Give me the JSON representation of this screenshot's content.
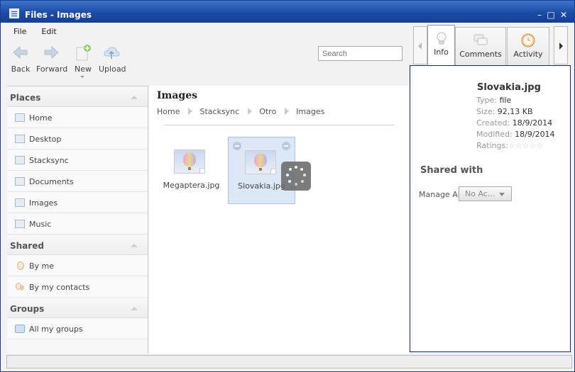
{
  "window": {
    "title": "Files - Images",
    "controls": [
      "minimize-icon",
      "maximize-icon",
      "close-icon"
    ]
  },
  "menu": {
    "items": [
      "File",
      "Edit"
    ]
  },
  "toolbar": {
    "back": "Back",
    "forward": "Forward",
    "new": "New",
    "upload": "Upload"
  },
  "search": {
    "placeholder": "Search"
  },
  "sidebar": {
    "places_title": "Places",
    "places": [
      "Home",
      "Desktop",
      "Stacksync",
      "Documents",
      "Images",
      "Music"
    ],
    "shared_title": "Shared",
    "shared": [
      "By me",
      "By my contacts"
    ],
    "groups_title": "Groups",
    "groups": [
      "All my groups"
    ]
  },
  "main": {
    "folder_title": "Images",
    "breadcrumbs": [
      "Home",
      "Stacksync",
      "Otro",
      "Images"
    ],
    "files": [
      {
        "name": "Megaptera.jpg",
        "selected": false
      },
      {
        "name": "Slovakia.jpg",
        "selected": true
      }
    ]
  },
  "right_panel": {
    "tabs": [
      "Info",
      "Comments",
      "Activity"
    ],
    "active_tab": "Info",
    "info": {
      "name": "Slovakia.jpg",
      "type_label": "Type:",
      "type": "file",
      "size_label": "Size:",
      "size": "92,13 KB",
      "created_label": "Created:",
      "created": "18/9/2014",
      "modified_label": "Modified:",
      "modified": "18/9/2014",
      "ratings_label": "Ratings:",
      "ratings": 0,
      "ratings_max": 5
    },
    "shared_with_title": "Shared with",
    "manage_all_label": "Manage All",
    "manage_all_value": "No Ac..."
  },
  "colors": {
    "titlebar": "#1b4ba6",
    "selection": "#dde8f7",
    "panel_border": "#0b2b6e"
  }
}
